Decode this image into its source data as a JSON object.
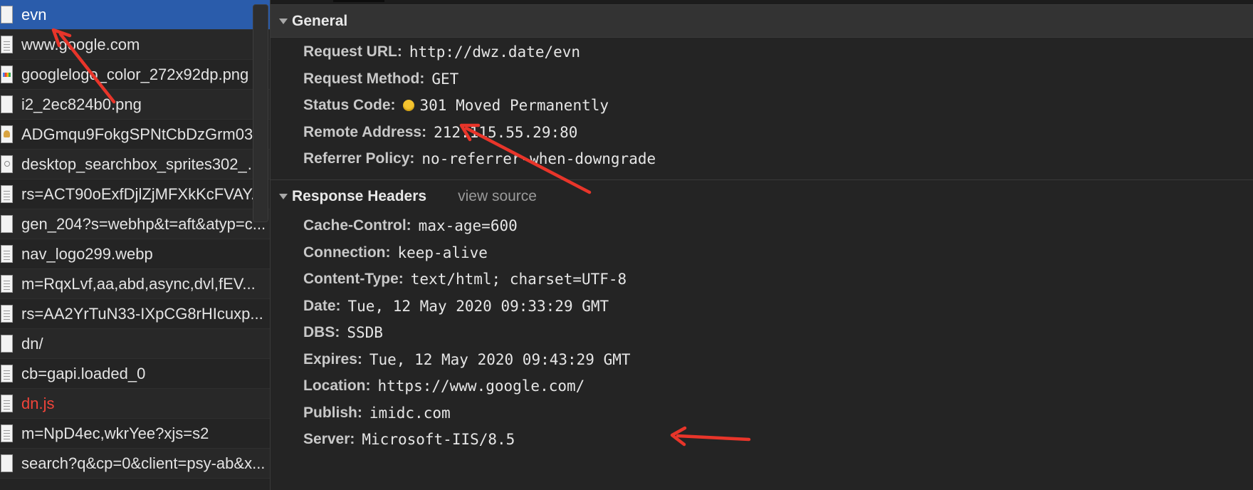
{
  "requests": [
    {
      "label": "evn",
      "icon": "blank-file-icon",
      "selected": true
    },
    {
      "label": "www.google.com",
      "icon": "document-icon"
    },
    {
      "label": "googlelogo_color_272x92dp.png",
      "icon": "google-logo-thumbnail-icon"
    },
    {
      "label": "i2_2ec824b0.png",
      "icon": "blank-file-icon"
    },
    {
      "label": "ADGmqu9FokgSPNtCbDzGrm03...",
      "icon": "image-thumbnail-icon"
    },
    {
      "label": "desktop_searchbox_sprites302_h...",
      "icon": "search-sprite-icon"
    },
    {
      "label": "rs=ACT90oExfDjlZjMFXkKcFVAY...",
      "icon": "document-icon"
    },
    {
      "label": "gen_204?s=webhp&t=aft&atyp=c...",
      "icon": "blank-file-icon"
    },
    {
      "label": "nav_logo299.webp",
      "icon": "document-icon"
    },
    {
      "label": "m=RqxLvf,aa,abd,async,dvl,fEV...",
      "icon": "document-icon"
    },
    {
      "label": "rs=AA2YrTuN33-IXpCG8rHIcuxp...",
      "icon": "document-icon"
    },
    {
      "label": "dn/",
      "icon": "blank-file-icon"
    },
    {
      "label": "cb=gapi.loaded_0",
      "icon": "document-icon"
    },
    {
      "label": "dn.js",
      "icon": "document-icon",
      "error": true
    },
    {
      "label": "m=NpD4ec,wkrYee?xjs=s2",
      "icon": "document-icon"
    },
    {
      "label": "search?q&cp=0&client=psy-ab&x...",
      "icon": "blank-file-icon"
    }
  ],
  "general": {
    "title": "General",
    "rows": [
      {
        "name": "Request URL:",
        "value": "http://dwz.date/evn"
      },
      {
        "name": "Request Method:",
        "value": "GET"
      },
      {
        "name": "Status Code:",
        "value": "301 Moved Permanently",
        "status_color": "#f4c430"
      },
      {
        "name": "Remote Address:",
        "value": "212.115.55.29:80"
      },
      {
        "name": "Referrer Policy:",
        "value": "no-referrer-when-downgrade"
      }
    ]
  },
  "response_headers": {
    "title": "Response Headers",
    "view_source": "view source",
    "rows": [
      {
        "name": "Cache-Control:",
        "value": "max-age=600"
      },
      {
        "name": "Connection:",
        "value": "keep-alive"
      },
      {
        "name": "Content-Type:",
        "value": "text/html; charset=UTF-8"
      },
      {
        "name": "Date:",
        "value": "Tue, 12 May 2020 09:33:29 GMT"
      },
      {
        "name": "DBS:",
        "value": "SSDB"
      },
      {
        "name": "Expires:",
        "value": "Tue, 12 May 2020 09:43:29 GMT"
      },
      {
        "name": "Location:",
        "value": "https://www.google.com/"
      },
      {
        "name": "Publish:",
        "value": "imidc.com"
      },
      {
        "name": "Server:",
        "value": "Microsoft-IIS/8.5"
      }
    ]
  },
  "colors": {
    "selected_row": "#2a5cab",
    "error_text": "#f0443a",
    "annotation_arrow": "#e8352a"
  }
}
